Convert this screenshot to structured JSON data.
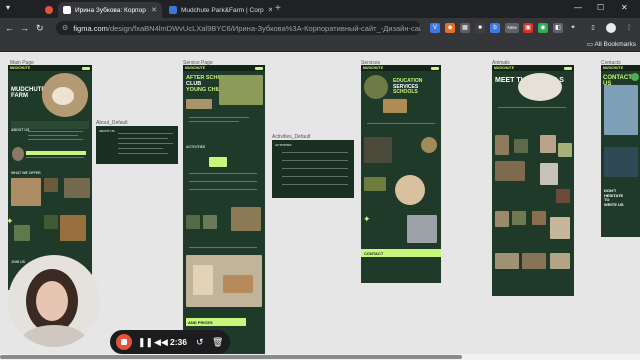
{
  "browser": {
    "tabs": [
      {
        "title": "Ирина Зубкова: Корпор",
        "active": true
      },
      {
        "title": "Mudchute Park&Farm | Corp",
        "active": false
      }
    ],
    "url_host": "figma.com",
    "url_path": "/design/fxaBN4lmDWvUcLXal9BYC6/Ирина-Зубкова%3A-Корпоративный-сайт_-Дизайн-сай...",
    "all_bookmarks": "All Bookmarks",
    "extension_badge": "New"
  },
  "canvas": {
    "frame_labels": {
      "main": "Main Page",
      "service": "Service Page",
      "services": "Services",
      "animals": "Animals",
      "contacts": "Contacts",
      "about": "About_Default",
      "activities": "Activities_Default"
    },
    "logo": "MUDCHUTE",
    "main_hero": "MUDCHUTE FARM",
    "main_about": "ABOUT US",
    "main_what": "WHAT WE OFFER",
    "main_join": "JOIN US",
    "service_hero": [
      "AFTER SCHOOL",
      "CLUB",
      "YOUNG CHILDREN"
    ],
    "service_activities": "ACTIVITIES",
    "service_prices": "AND PRICES",
    "services_hero": [
      "EDUCATION",
      "SERVICES",
      "SCHOOLS"
    ],
    "services_contact": "CONTACT",
    "animals_hero": "MEET THE ANIMALS",
    "contacts_hero": "CONTACT US",
    "contacts_cta": [
      "DON'T",
      "HESITATE",
      "TO",
      "WRITE US"
    ],
    "about_card_title": "ABOUT US",
    "activities_card_title": "ACTIVITIES"
  },
  "recorder": {
    "time": "2:36"
  },
  "colors": {
    "frame_bg": "#1f3a28",
    "accent": "#c9f57a",
    "chrome_dark": "#202124",
    "record": "#e5533c"
  }
}
